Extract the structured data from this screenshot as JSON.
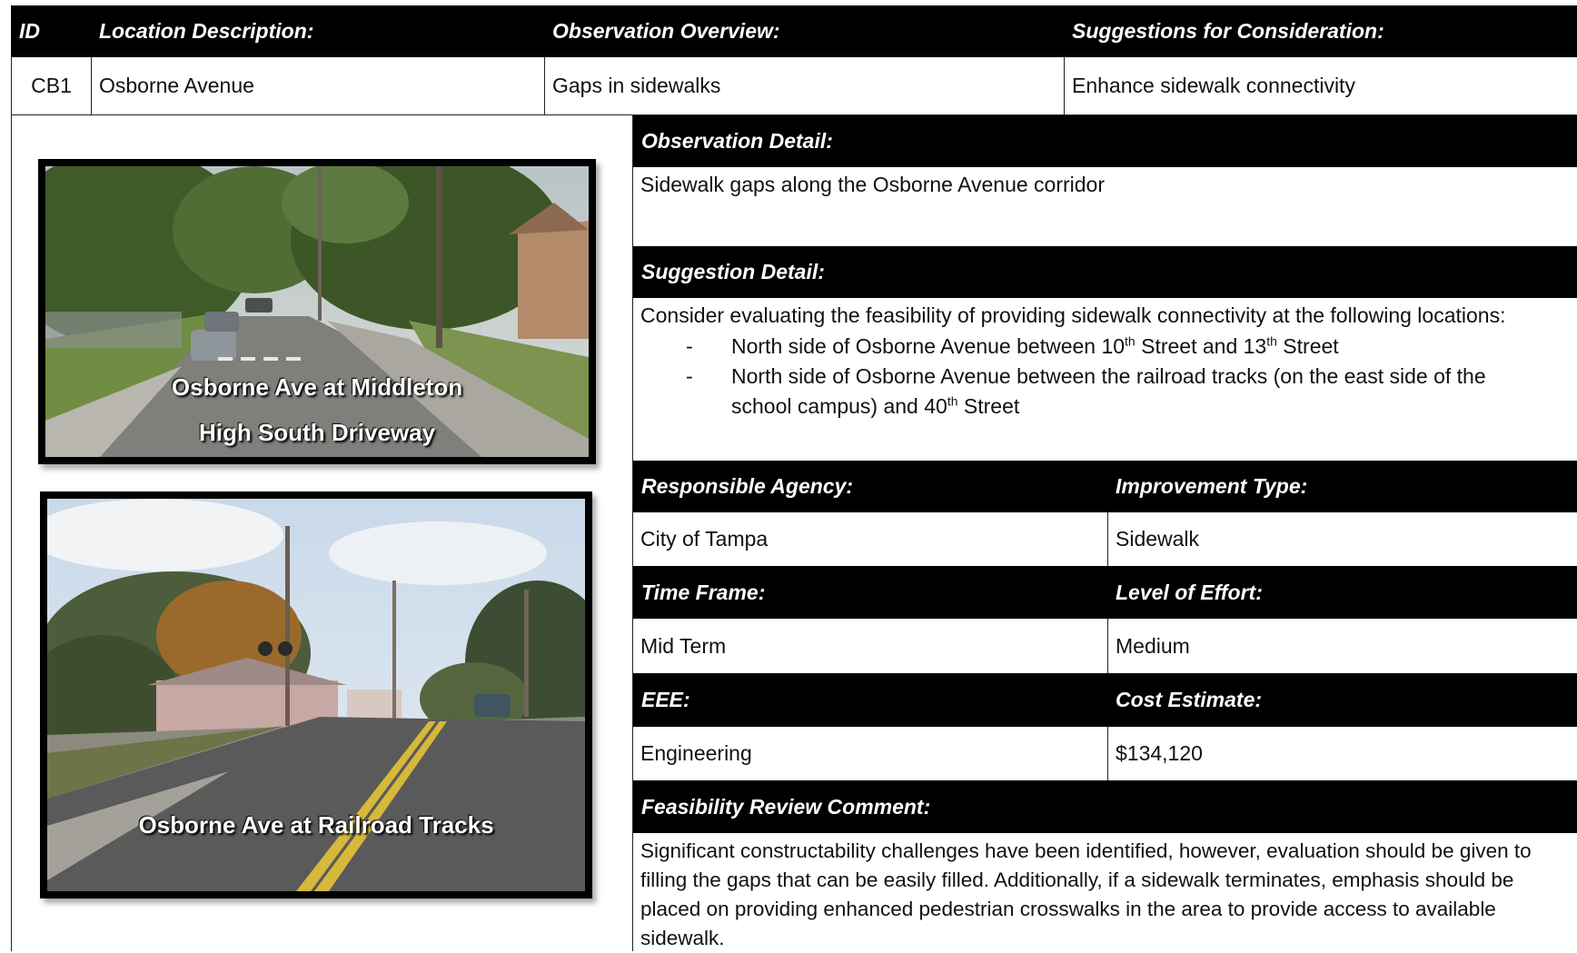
{
  "header": {
    "id": "ID",
    "location": "Location Description:",
    "overview": "Observation Overview:",
    "suggestions": "Suggestions for Consideration:"
  },
  "row": {
    "id": "CB1",
    "location": "Osborne Avenue",
    "overview": "Gaps in sidewalks",
    "suggestions": "Enhance sidewalk connectivity"
  },
  "photos": [
    {
      "caption_line1": "Osborne Ave at Middleton",
      "caption_line2": "High South Driveway"
    },
    {
      "caption": "Osborne Ave at Railroad Tracks"
    }
  ],
  "observation": {
    "label": "Observation Detail:",
    "text": "Sidewalk gaps along the Osborne Avenue corridor"
  },
  "suggestion": {
    "label": "Suggestion Detail:",
    "intro": "Consider evaluating the feasibility of providing sidewalk connectivity at the following locations:",
    "bullet_dash": "-",
    "b1_part1": "North side of Osborne Avenue between 10",
    "b1_sup1": "th",
    "b1_part2": " Street and 13",
    "b1_sup2": "th",
    "b1_part3": " Street",
    "b2_part1": "North side of Osborne Avenue between the railroad tracks (on the east side of the school campus) and 40",
    "b2_sup": "th",
    "b2_part2": " Street"
  },
  "details": {
    "agency_label": "Responsible Agency:",
    "agency_value": "City of Tampa",
    "type_label": "Improvement Type:",
    "type_value": "Sidewalk",
    "timeframe_label": "Time Frame:",
    "timeframe_value": "Mid Term",
    "effort_label": "Level of Effort:",
    "effort_value": "Medium",
    "eee_label": "EEE:",
    "eee_value": "Engineering",
    "cost_label": "Cost Estimate:",
    "cost_value": "$134,120"
  },
  "feasibility": {
    "label": "Feasibility Review Comment:",
    "text": "Significant constructability challenges have been identified, however, evaluation should be given to filling the gaps that can be easily filled. Additionally, if a sidewalk terminates, emphasis should be placed on providing enhanced pedestrian crosswalks in the area to provide access to available sidewalk."
  }
}
